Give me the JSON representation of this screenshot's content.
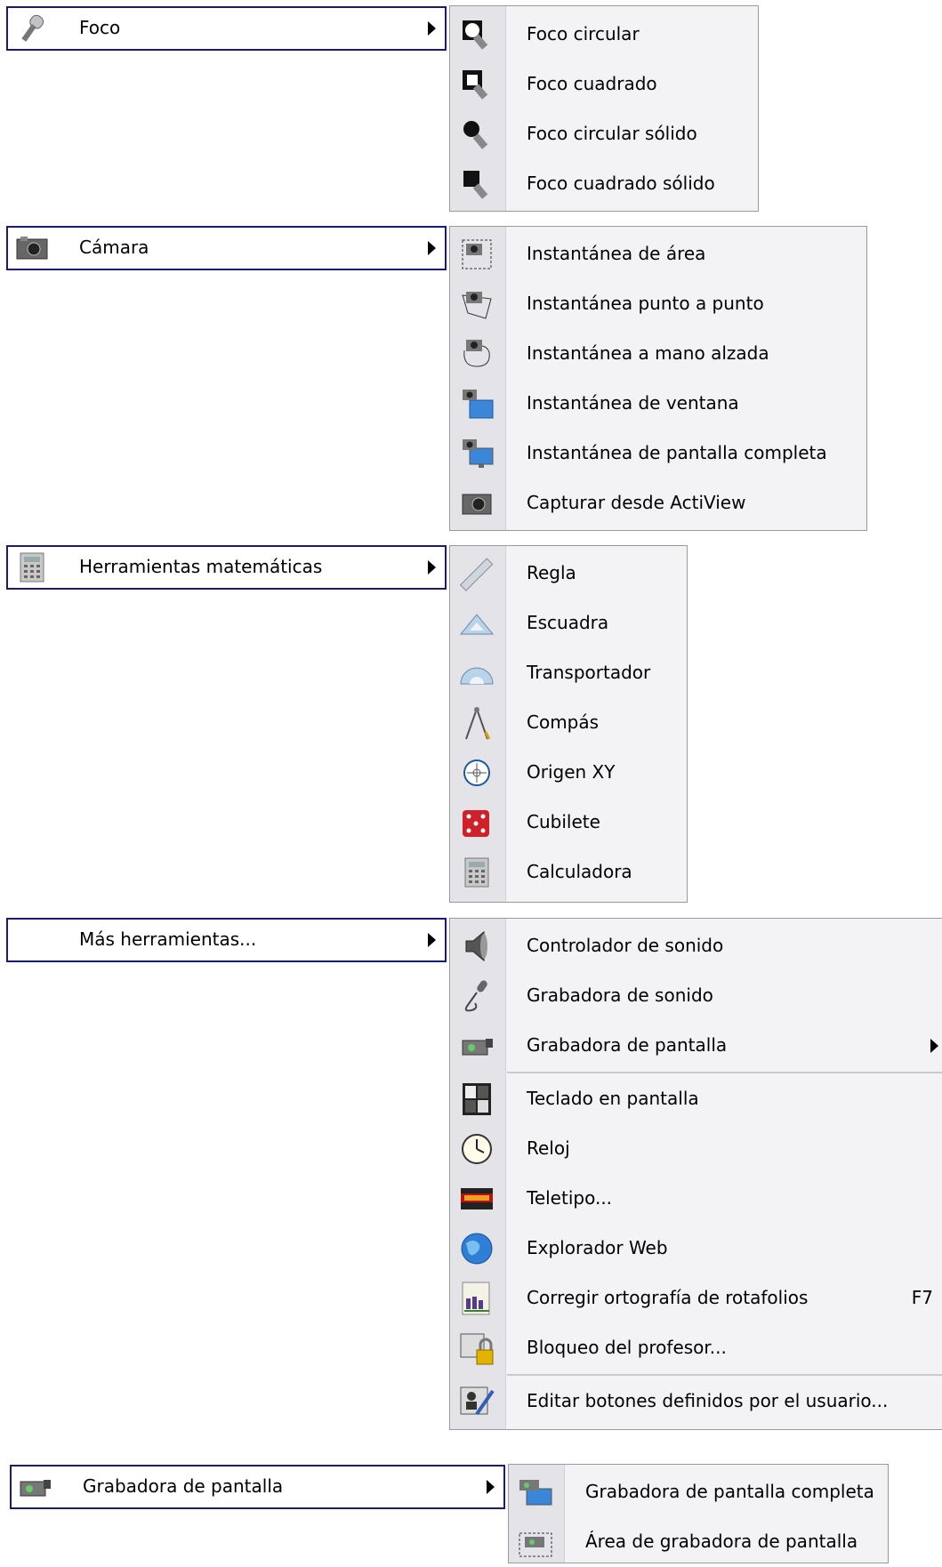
{
  "foco": {
    "parent_label": "Foco",
    "items": [
      "Foco circular",
      "Foco cuadrado",
      "Foco circular sólido",
      "Foco cuadrado sólido"
    ]
  },
  "camara": {
    "parent_label": "Cámara",
    "items": [
      "Instantánea de área",
      "Instantánea punto a punto",
      "Instantánea a mano alzada",
      "Instantánea de ventana",
      "Instantánea de pantalla completa",
      "Capturar desde ActiView"
    ]
  },
  "matematicas": {
    "parent_label": "Herramientas matemáticas",
    "items": [
      "Regla",
      "Escuadra",
      "Transportador",
      "Compás",
      "Origen XY",
      "Cubilete",
      "Calculadora"
    ]
  },
  "mas": {
    "parent_label": "Más herramientas...",
    "items": [
      "Controlador de sonido",
      "Grabadora de sonido",
      "Grabadora de pantalla",
      "Teclado en pantalla",
      "Reloj",
      "Teletipo...",
      "Explorador Web",
      "Corregir ortografía de rotafolios",
      "Bloqueo del profesor...",
      "Editar botones definidos por el usuario..."
    ],
    "shortcut": "F7"
  },
  "grabadora": {
    "parent_label": "Grabadora de pantalla",
    "items": [
      "Grabadora de pantalla completa",
      "Área de grabadora de pantalla"
    ]
  }
}
